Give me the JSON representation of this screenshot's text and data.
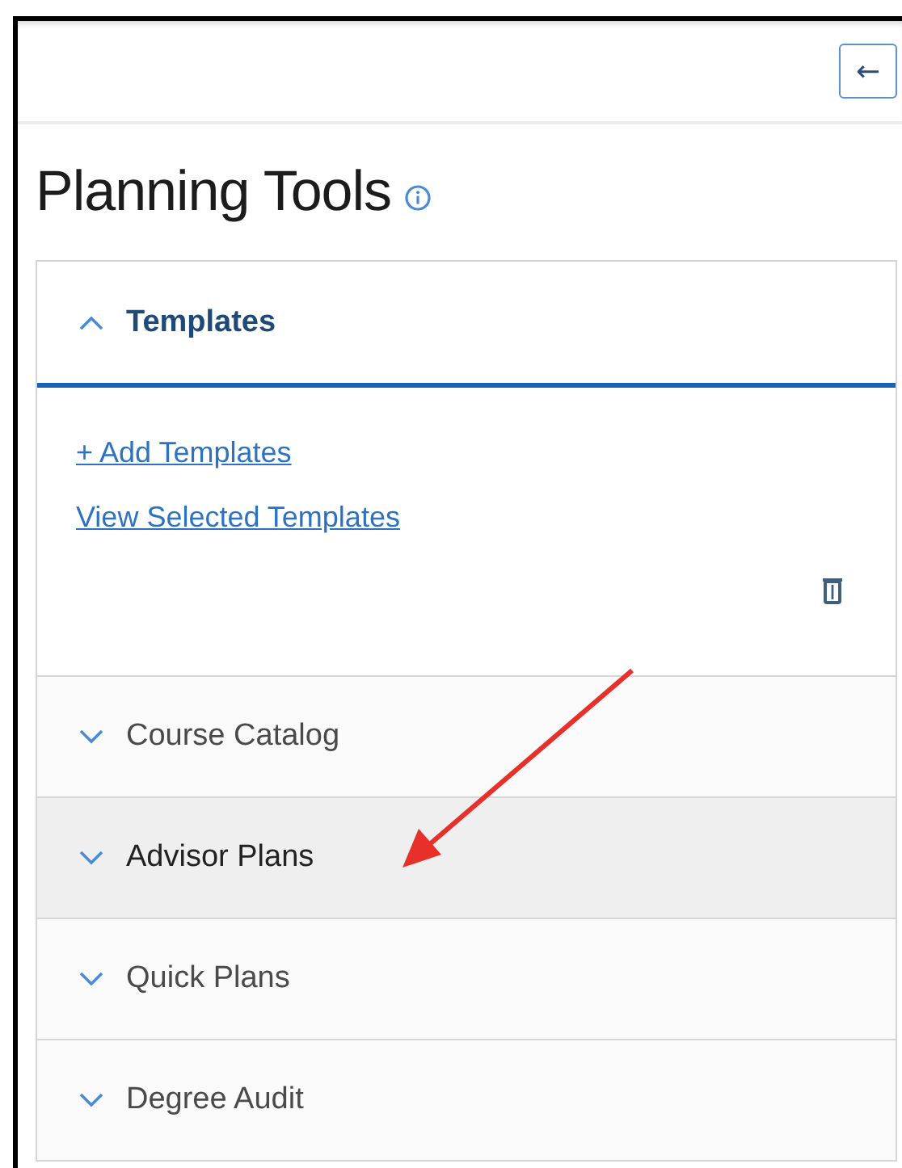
{
  "header": {
    "back_button": "←"
  },
  "title": "Planning Tools",
  "sections": [
    {
      "label": "Templates",
      "expanded": true,
      "highlighted": false,
      "links": [
        "+ Add Templates",
        "View Selected Templates"
      ]
    },
    {
      "label": "Course Catalog",
      "expanded": false,
      "highlighted": false
    },
    {
      "label": "Advisor Plans",
      "expanded": false,
      "highlighted": true
    },
    {
      "label": "Quick Plans",
      "expanded": false,
      "highlighted": false
    },
    {
      "label": "Degree Audit",
      "expanded": false,
      "highlighted": false
    }
  ]
}
